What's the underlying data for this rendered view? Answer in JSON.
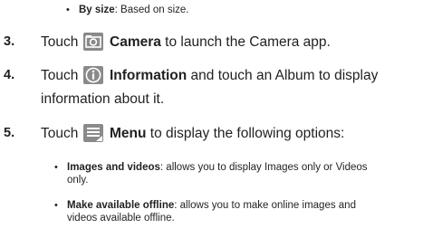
{
  "bullet_top": {
    "term": "By size",
    "desc": ": Based on size."
  },
  "steps": [
    {
      "num": "3.",
      "pre": "Touch",
      "icon": "camera-icon",
      "bold": "Camera",
      "post": " to launch the Camera app."
    },
    {
      "num": "4.",
      "pre": "Touch",
      "icon": "information-icon",
      "bold": "Information",
      "post": " and touch an Album to display",
      "cont": "information about it."
    },
    {
      "num": "5.",
      "pre": "Touch",
      "icon": "menu-icon",
      "bold": "Menu",
      "post": " to display the following options:"
    }
  ],
  "options": [
    {
      "term": "Images and videos",
      "desc": ": allows you to display Images only or Videos",
      "cont": "only."
    },
    {
      "term": "Make available offline",
      "desc": ": allows you to make online images and",
      "cont": "videos available offline."
    }
  ]
}
